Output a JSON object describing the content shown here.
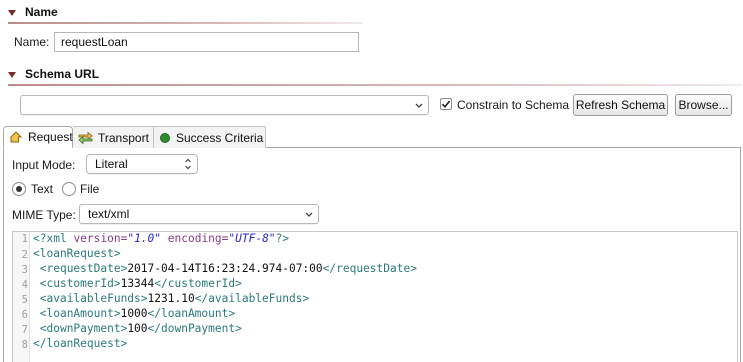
{
  "sections": {
    "name": {
      "title": "Name",
      "field_label": "Name:",
      "field_value": "requestLoan"
    },
    "schema": {
      "title": "Schema URL",
      "url_value": "",
      "constrain_label": "Constrain to Schema",
      "constrain_checked": true,
      "refresh_label": "Refresh Schema",
      "browse_label": "Browse..."
    }
  },
  "tabs": [
    {
      "label": "Request",
      "icon": "request-arrow-icon",
      "active": true
    },
    {
      "label": "Transport",
      "icon": "transport-arrows-icon",
      "active": false
    },
    {
      "label": "Success Criteria",
      "icon": "green-circle-icon",
      "active": false
    }
  ],
  "request": {
    "input_mode_label": "Input Mode:",
    "input_mode_value": "Literal",
    "radio_text_label": "Text",
    "radio_file_label": "File",
    "radio_selected": "Text",
    "mime_label": "MIME Type:",
    "mime_value": "text/xml"
  },
  "editor": {
    "line_numbers": [
      "1",
      "2",
      "3",
      "4",
      "5",
      "6",
      "7",
      "8"
    ],
    "xml_decl": {
      "open": "<?xml",
      "version_attr": "version=",
      "version_val": "\"1.0\"",
      "encoding_attr": "encoding=",
      "encoding_val": "\"UTF-8\"",
      "close": "?>"
    },
    "lines": [
      {
        "indent": "",
        "open": "<loanRequest>",
        "text": "",
        "close": ""
      },
      {
        "indent": " ",
        "open": "<requestDate>",
        "text": "2017-04-14T16:23:24.974-07:00",
        "close": "</requestDate>"
      },
      {
        "indent": " ",
        "open": "<customerId>",
        "text": "13344",
        "close": "</customerId>"
      },
      {
        "indent": " ",
        "open": "<availableFunds>",
        "text": "1231.10",
        "close": "</availableFunds>"
      },
      {
        "indent": " ",
        "open": "<loanAmount>",
        "text": "1000",
        "close": "</loanAmount>"
      },
      {
        "indent": " ",
        "open": "<downPayment>",
        "text": "100",
        "close": "</downPayment>"
      },
      {
        "indent": "",
        "open": "</loanRequest>",
        "text": "",
        "close": ""
      }
    ]
  },
  "colors": {
    "section_triangle": "#7a2a2a",
    "xml_tag": "#2a7a7a",
    "xml_attr": "#8a3a8a",
    "xml_value": "#2a2ad0",
    "success_dot": "#2e8a2e"
  }
}
